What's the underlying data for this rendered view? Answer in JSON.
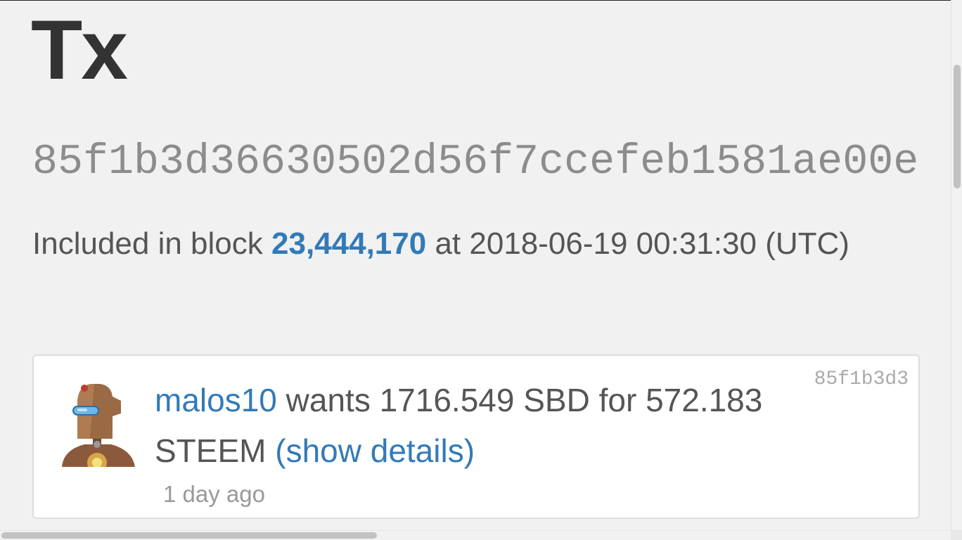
{
  "page": {
    "title": "Tx",
    "tx_hash": "85f1b3d36630502d56f7ccefeb1581ae00e"
  },
  "included": {
    "prefix": "Included in block ",
    "block_number": "23,444,170",
    "middle": " at ",
    "timestamp": "2018-06-19 00:31:30",
    "tz": "(UTC)"
  },
  "operation": {
    "account": "malos10",
    "text_wants": " wants 1716.549 SBD for 572.183 STEEM ",
    "details_link": "(show details)",
    "short_hash": "85f1b3d3",
    "time_ago": "1 day ago",
    "avatar_icon": "robot-avatar-icon"
  },
  "colors": {
    "link": "#337ab7",
    "background": "#f1f1f1",
    "card": "#ffffff",
    "muted": "#8c8c8c"
  }
}
